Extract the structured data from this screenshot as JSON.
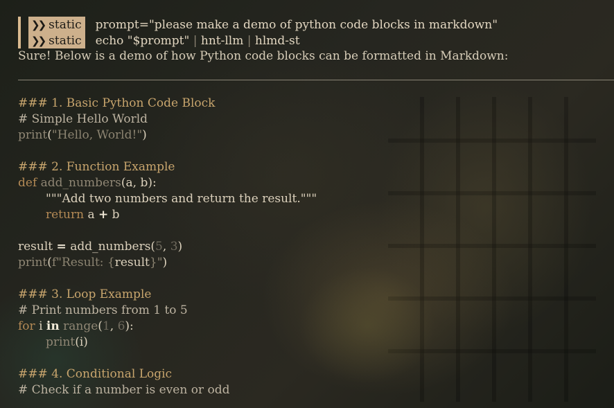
{
  "prompt_rows": [
    {
      "segment": "static",
      "command": "prompt=\"please make a demo of python code blocks in markdown\""
    },
    {
      "segment": "static",
      "command": "echo \"$prompt\"",
      "pipes": [
        "hnt-llm",
        "hlmd-st"
      ]
    }
  ],
  "response_intro": "Sure! Below is a demo of how Python code blocks can be formatted in Markdown:",
  "sections": {
    "basic": {
      "heading": "### 1. Basic Python Code Block",
      "comment": "# Simple Hello World",
      "print_fn": "print",
      "print_arg": "\"Hello, World!\""
    },
    "function": {
      "heading": "### 2. Function Example",
      "def_kw": "def",
      "fn_name": "add_numbers",
      "params": "(a, b):",
      "docstring": "\"\"\"Add two numbers and return the result.\"\"\"",
      "return_kw": "return",
      "return_expr_a": "a",
      "plus": "+",
      "return_expr_b": "b",
      "assign_var": "result",
      "assign_op": "=",
      "call_name": "add_numbers(",
      "arg1": "5",
      "arg2": "3",
      "print_fn": "print",
      "fstring_open": "f\"Result: {",
      "fstring_var": "result",
      "fstring_close": "}\""
    },
    "loop": {
      "heading": "### 3. Loop Example",
      "comment": "# Print numbers from 1 to 5",
      "for_kw": "for",
      "var": "i",
      "in_kw": "in",
      "range_fn": "range",
      "range_a": "1",
      "range_b": "6",
      "body_print": "print",
      "body_arg": "(i)"
    },
    "conditional": {
      "heading": "### 4. Conditional Logic",
      "comment": "# Check if a number is even or odd"
    }
  }
}
